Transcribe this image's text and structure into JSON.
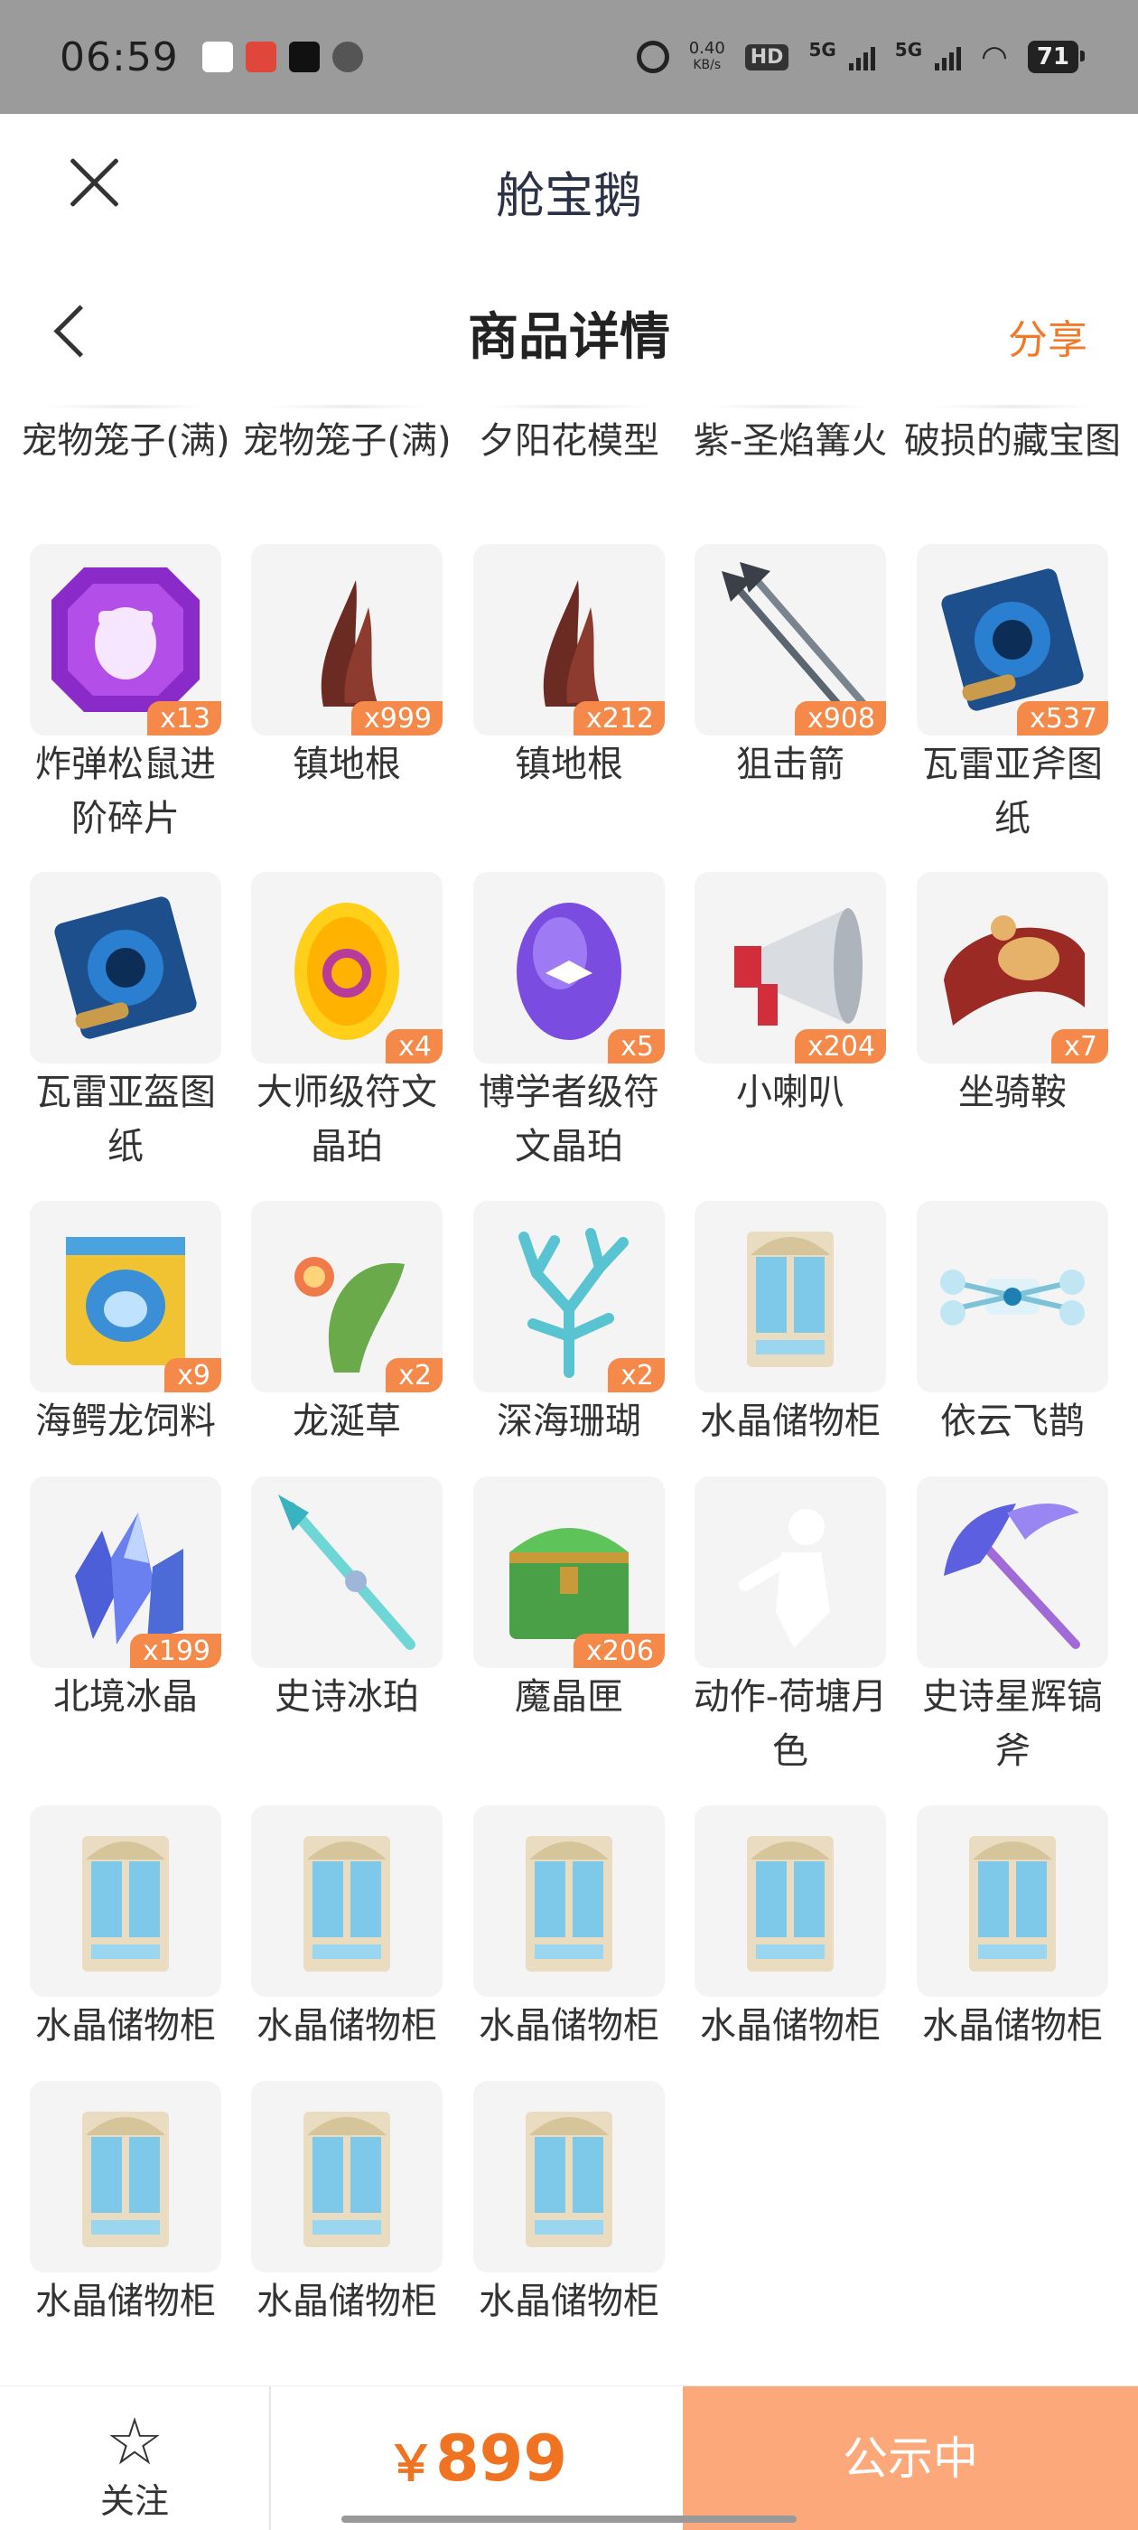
{
  "status_bar": {
    "time": "06:59",
    "speed": "0.40",
    "speed_unit": "KB/s",
    "hd": "HD",
    "net1": "5G",
    "net2": "5G",
    "battery": "71"
  },
  "mini_program": {
    "title": "舱宝鹅"
  },
  "page": {
    "title": "商品详情",
    "share": "分享"
  },
  "top_row": [
    "宠物笼子(满)",
    "宠物笼子(满)",
    "夕阳花模型",
    "紫-圣焰篝火",
    "破损的藏宝图"
  ],
  "items": [
    {
      "name": "炸弹松鼠进阶碎片",
      "count": "x13",
      "icon": "purple-gem-icon"
    },
    {
      "name": "镇地根",
      "count": "x999",
      "icon": "root-icon"
    },
    {
      "name": "镇地根",
      "count": "x212",
      "icon": "root-icon"
    },
    {
      "name": "狙击箭",
      "count": "x908",
      "icon": "arrows-icon"
    },
    {
      "name": "瓦雷亚斧图纸",
      "count": "x537",
      "icon": "blueprint-icon"
    },
    {
      "name": "瓦雷亚盔图纸",
      "count": "",
      "icon": "blueprint-icon"
    },
    {
      "name": "大师级符文晶珀",
      "count": "x4",
      "icon": "gold-egg-icon"
    },
    {
      "name": "博学者级符文晶珀",
      "count": "x5",
      "icon": "purple-egg-icon"
    },
    {
      "name": "小喇叭",
      "count": "x204",
      "icon": "megaphone-icon"
    },
    {
      "name": "坐骑鞍",
      "count": "x7",
      "icon": "saddle-icon"
    },
    {
      "name": "海鳄龙饲料",
      "count": "x9",
      "icon": "feed-bag-icon"
    },
    {
      "name": "龙涎草",
      "count": "x2",
      "icon": "plant-icon"
    },
    {
      "name": "深海珊瑚",
      "count": "x2",
      "icon": "coral-icon"
    },
    {
      "name": "水晶储物柜",
      "count": "",
      "icon": "cabinet-icon"
    },
    {
      "name": "依云飞鹊",
      "count": "",
      "icon": "drone-icon"
    },
    {
      "name": "北境冰晶",
      "count": "x199",
      "icon": "ice-crystal-icon"
    },
    {
      "name": "史诗冰珀",
      "count": "",
      "icon": "spear-icon"
    },
    {
      "name": "魔晶匣",
      "count": "x206",
      "icon": "chest-icon"
    },
    {
      "name": "动作-荷塘月色",
      "count": "",
      "icon": "dance-figure-icon"
    },
    {
      "name": "史诗星辉镐斧",
      "count": "",
      "icon": "pickaxe-icon"
    },
    {
      "name": "水晶储物柜",
      "count": "",
      "icon": "cabinet-icon"
    },
    {
      "name": "水晶储物柜",
      "count": "",
      "icon": "cabinet-icon"
    },
    {
      "name": "水晶储物柜",
      "count": "",
      "icon": "cabinet-icon"
    },
    {
      "name": "水晶储物柜",
      "count": "",
      "icon": "cabinet-icon"
    },
    {
      "name": "水晶储物柜",
      "count": "",
      "icon": "cabinet-icon"
    },
    {
      "name": "水晶储物柜",
      "count": "",
      "icon": "cabinet-icon"
    },
    {
      "name": "水晶储物柜",
      "count": "",
      "icon": "cabinet-icon"
    },
    {
      "name": "水晶储物柜",
      "count": "",
      "icon": "cabinet-icon"
    }
  ],
  "bottom": {
    "follow": "关注",
    "currency": "￥",
    "price": "899",
    "status": "公示中"
  },
  "colors": {
    "accent": "#f07322",
    "badge": "#f5894a",
    "status_button": "#fca87a"
  }
}
